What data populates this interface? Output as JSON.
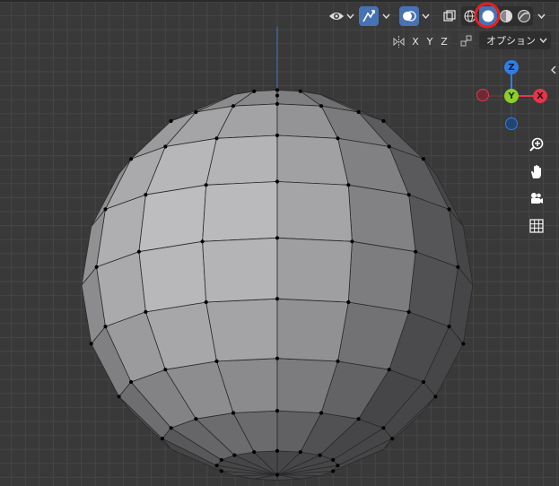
{
  "header": {
    "options_label": "オプション",
    "axis_x": "X",
    "axis_y": "Y",
    "axis_z": "Z"
  },
  "gizmo": {
    "z_label": "Z",
    "y_label": "Y",
    "x_label": "X",
    "colors": {
      "x": "#e2364b",
      "y": "#8ccf27",
      "z": "#2f7ee8"
    }
  },
  "icons": {
    "visibility": "eye-icon",
    "gizmos": "gizmo-arrow-icon",
    "overlays": "overlay-icon",
    "xray": "xray-icon",
    "wireframe": "wireframe-shading-icon",
    "solid": "solid-shading-icon",
    "material": "material-preview-icon",
    "rendered": "rendered-shading-icon",
    "zoom": "zoom-icon",
    "pan": "hand-icon",
    "camera": "camera-icon",
    "ortho": "ortho-grid-icon"
  },
  "highlight": {
    "color": "#e8201e",
    "target": "solid-shading-button"
  }
}
